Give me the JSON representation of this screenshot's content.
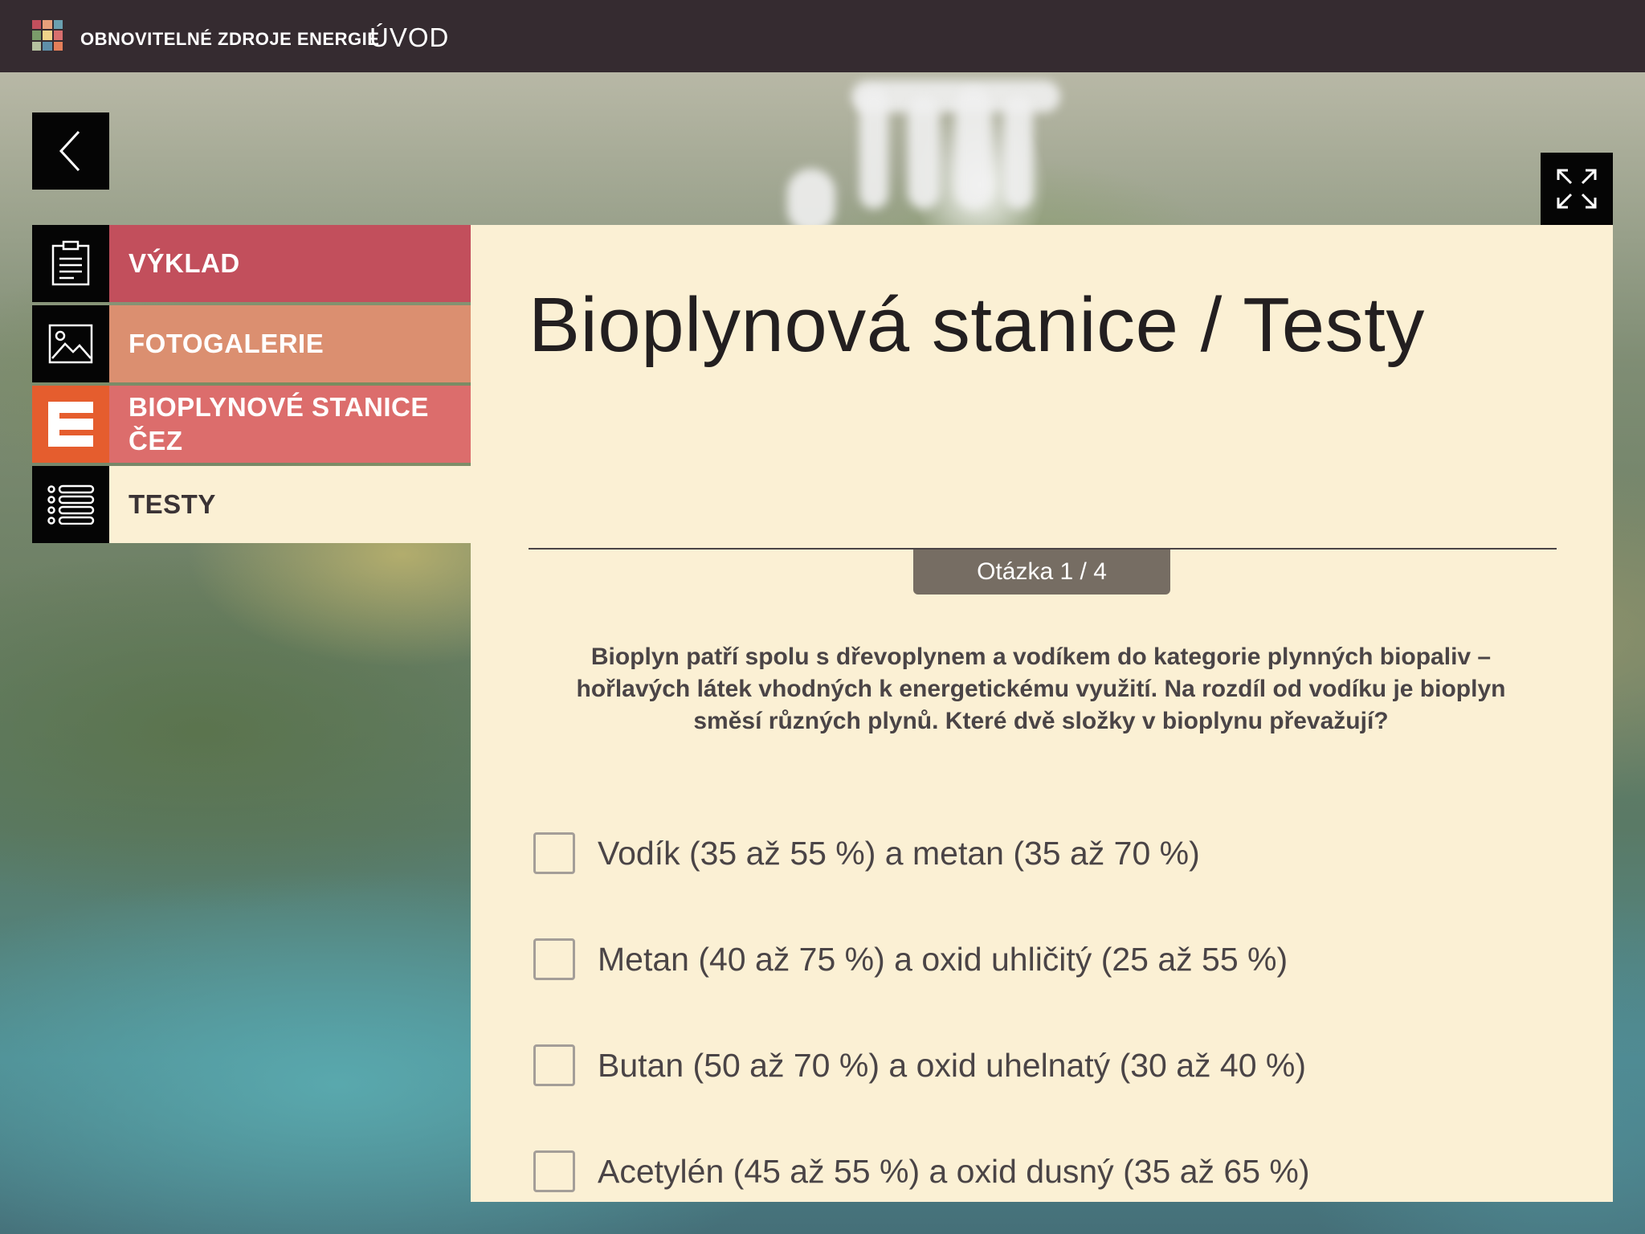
{
  "header": {
    "app_title": "OBNOVITELNÉ ZDROJE ENERGIE",
    "section": "ÚVOD"
  },
  "sidebar": {
    "items": [
      {
        "label": "VÝKLAD",
        "icon": "clipboard-icon",
        "color": "#c24f5c"
      },
      {
        "label": "FOTOGALERIE",
        "icon": "image-icon",
        "color": "#db8f70"
      },
      {
        "label": "BIOPLYNOVÉ STANICE ČEZ",
        "icon": "cez-logo-icon",
        "color": "#dc6d6c"
      },
      {
        "label": "TESTY",
        "icon": "list-icon",
        "color": "#fbf0d4"
      }
    ]
  },
  "main": {
    "title": "Bioplynová stanice / Testy",
    "question_counter": "Otázka 1 / 4",
    "question": "Bioplyn patří spolu s dřevoplynem a vodíkem do kategorie plynných biopaliv – hořlavých látek vhodných k energetickému využití. Na rozdíl od vodíku je bioplyn směsí různých plynů. Které dvě složky v bioplynu převažují?",
    "answers": [
      {
        "label": "Vodík (35 až 55 %) a metan (35 až 70 %)",
        "checked": false
      },
      {
        "label": "Metan (40 až 75 %) a oxid uhličitý (25 až 55 %)",
        "checked": false
      },
      {
        "label": "Butan (50 až 70 %) a oxid uhelnatý (30 až 40 %)",
        "checked": false
      },
      {
        "label": "Acetylén (45 až 55 %) a oxid dusný (35 až 65 %)",
        "checked": false
      }
    ]
  },
  "colors": {
    "topbar": "#352b30",
    "panel": "#fbf0d4",
    "badge": "#766d63",
    "cez_orange": "#e55d2e"
  }
}
